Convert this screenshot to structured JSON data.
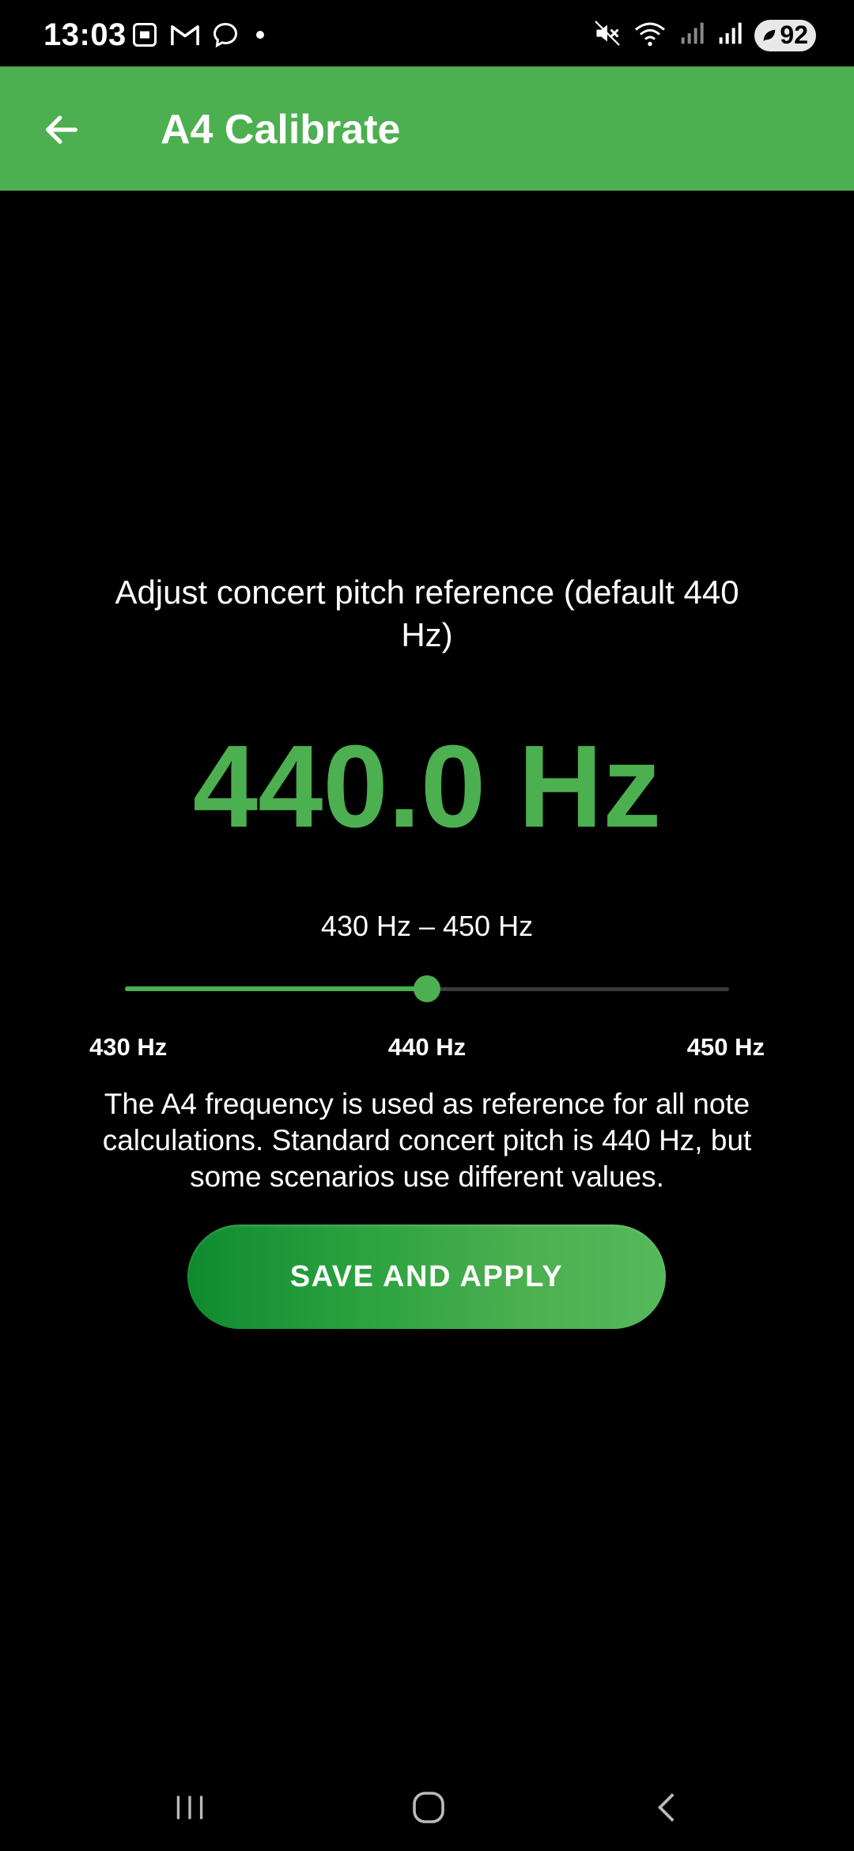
{
  "status_bar": {
    "time": "13:03",
    "battery": "92",
    "notification_icons": [
      "screenshot-icon",
      "gmail-icon",
      "chat-bubble-icon",
      "dot-icon"
    ],
    "system_icons": [
      "mute-icon",
      "wifi-icon",
      "signal-icon",
      "signal-icon"
    ]
  },
  "app_bar": {
    "title": "A4 Calibrate",
    "back_icon": "arrow-back-icon",
    "color": "#4caf50"
  },
  "main": {
    "subtitle": "Adjust concert pitch reference (default 440 Hz)",
    "frequency": "440.0 Hz",
    "range_label": "430 Hz – 450 Hz",
    "slider": {
      "min_label": "430 Hz",
      "mid_label": "440 Hz",
      "max_label": "450 Hz",
      "min": 430,
      "max": 450,
      "value": 440
    },
    "description": "The A4 frequency is used as reference for all note calculations. Standard concert pitch is 440 Hz, but some scenarios use different values.",
    "save_button": "SAVE AND APPLY"
  },
  "nav_bar": {
    "buttons": [
      "recent-apps-icon",
      "home-icon",
      "back-icon"
    ]
  }
}
